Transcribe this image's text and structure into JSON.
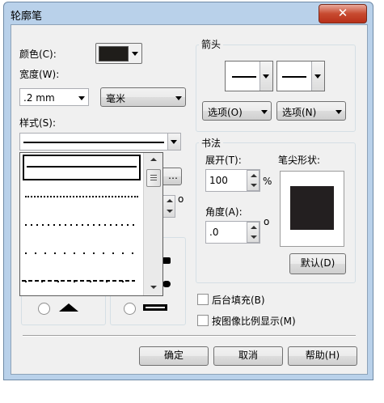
{
  "window": {
    "title": "轮廓笔",
    "close_glyph": "✕"
  },
  "color": {
    "label": "颜色(C):",
    "swatch": "#1f1d1a"
  },
  "width": {
    "label": "宽度(W):",
    "value": ".2 mm",
    "unit": "毫米"
  },
  "style": {
    "label": "样式(S):"
  },
  "style_list": {
    "items": [
      "solid",
      "dotted-fine",
      "dotted-1",
      "dotted-2",
      "dotted-3",
      "dashed"
    ]
  },
  "background": {
    "degree_1": "o",
    "degree_2": "o"
  },
  "arrows": {
    "title": "箭头",
    "options_left": "选项(O)",
    "options_right": "选项(N)"
  },
  "calligraphy": {
    "title": "书法",
    "stretch_label": "展开(T):",
    "stretch_value": "100",
    "stretch_unit": "%",
    "angle_label": "角度(A):",
    "angle_value": ".0",
    "angle_unit": "o",
    "nib_label": "笔尖形状:",
    "default_button": "默认(D)",
    "nib_color": "#231f20"
  },
  "checks": {
    "behind_fill": "后台填充(B)",
    "scale_with_image": "按图像比例显示(M)"
  },
  "buttons": {
    "ok": "确定",
    "cancel": "取消",
    "help": "帮助(H)"
  },
  "colors": {
    "titlebar": "#b9d1ea",
    "close": "#c74a30",
    "dialog": "#f0f0f0"
  }
}
